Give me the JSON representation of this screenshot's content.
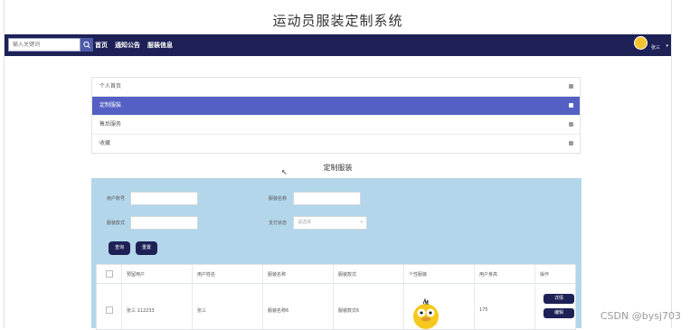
{
  "header": {
    "title": "运动员服装定制系统"
  },
  "navbar": {
    "search_placeholder": "输入关键词",
    "links": [
      "首页",
      "通知公告",
      "服装信息"
    ],
    "username": "张三",
    "colors": {
      "bar": "#1d2156",
      "search_button": "#4d5aa8"
    }
  },
  "sidebar": {
    "items": [
      {
        "label": "个人首页",
        "active": false
      },
      {
        "label": "定制服装",
        "active": true
      },
      {
        "label": "售后服务",
        "active": false
      },
      {
        "label": "收藏",
        "active": false
      }
    ],
    "active_color": "#5560c4"
  },
  "main": {
    "title": "定制服装",
    "filters": {
      "account_label": "用户账号",
      "clothing_name_label": "服装名称",
      "clothing_style_label": "服装款式",
      "payment_status_label": "支付状态",
      "payment_status_placeholder": "请选择"
    },
    "buttons": {
      "search": "查询",
      "reset": "重置"
    },
    "table": {
      "headers": [
        "",
        "预留用户",
        "用户姓名",
        "服装名称",
        "服装款式",
        "个性服装",
        "用户身高",
        "操作"
      ],
      "rows": [
        {
          "account": "张三 112233",
          "name": "张三",
          "clothing_name": "服装名称6",
          "clothing_style": "服装款式6",
          "height": "175",
          "actions": [
            "详情",
            "编辑"
          ]
        }
      ]
    },
    "panel_color": "#b3d6ea"
  },
  "watermark": "CSDN @bysj703"
}
